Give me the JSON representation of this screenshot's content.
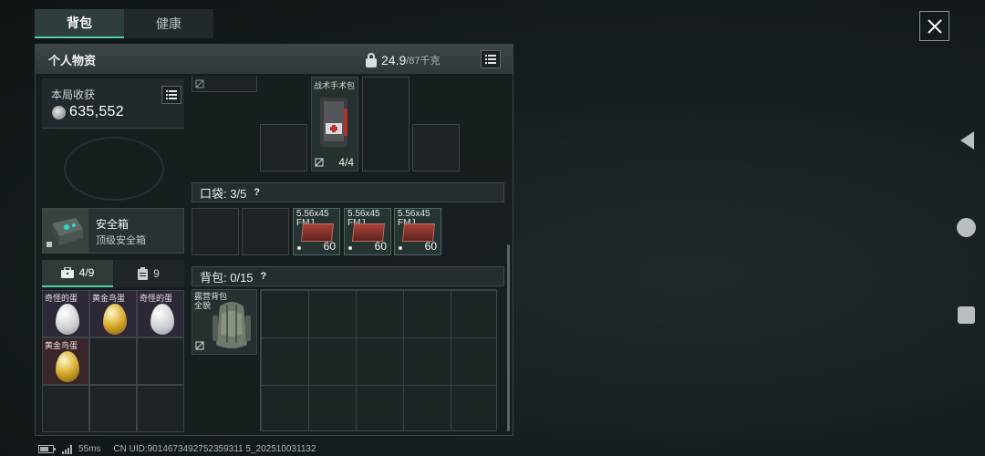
{
  "tabs": [
    {
      "label": "背包",
      "active": true
    },
    {
      "label": "健康",
      "active": false
    }
  ],
  "panel": {
    "title": "个人物资",
    "weight_current": "24.9",
    "weight_max": "/87千克"
  },
  "income": {
    "label": "本局收获",
    "value": "635,552"
  },
  "safebox": {
    "name": "安全箱",
    "subtitle": "顶级安全箱"
  },
  "subtabs": [
    {
      "label": "4/9",
      "icon": "briefcase-icon",
      "active": true
    },
    {
      "label": "9",
      "icon": "clipboard-icon",
      "active": false
    }
  ],
  "safe_items": [
    {
      "label": "奇怪的蛋",
      "egg": "white",
      "rarity": "purple"
    },
    {
      "label": "黄金鸟蛋",
      "egg": "gold",
      "rarity": "purple"
    },
    {
      "label": "奇怪的蛋",
      "egg": "white",
      "rarity": "purple"
    },
    {
      "label": "黄金鸟蛋",
      "egg": "gold",
      "rarity": "red"
    }
  ],
  "medkit": {
    "label": "战术手术包",
    "uses": "4/4"
  },
  "pockets": {
    "label": "口袋: 3/5",
    "help": "?",
    "ammo": [
      {
        "line1": "5.56x45",
        "line2": "FMJ",
        "count": "60"
      },
      {
        "line1": "5.56x45",
        "line2": "FMJ",
        "count": "60"
      },
      {
        "line1": "5.56x45",
        "line2": "FMJ",
        "count": "60"
      }
    ]
  },
  "backpack": {
    "label": "背包: 0/15",
    "help": "?",
    "item_line1": "露营背包",
    "item_line2": "全貌"
  },
  "status_bar": {
    "ping": "55ms",
    "uid": "CN UID:9014673492752359311 5_202510031132"
  },
  "colors": {
    "accent": "#4fd1a6",
    "purple_rarity": "#2c2838",
    "red_rarity": "#3a2528"
  }
}
